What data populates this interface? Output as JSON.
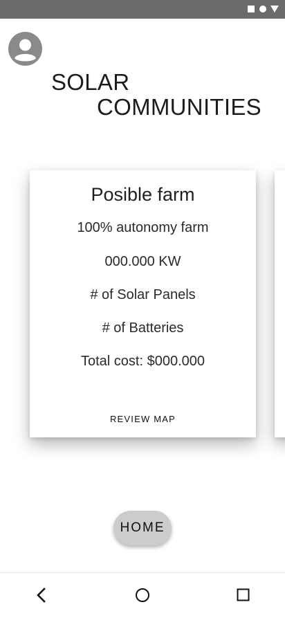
{
  "status_bar": {
    "icons": [
      "square-icon",
      "circle-icon",
      "triangle-icon"
    ]
  },
  "header": {
    "avatar_icon": "account-circle-icon",
    "title_line1": "SOLAR",
    "title_line2": "COMMUNITIES"
  },
  "card": {
    "title": "Posible farm",
    "autonomy": "100% autonomy farm",
    "power": "000.000 KW",
    "panels": "# of Solar Panels",
    "batteries": "# of Batteries",
    "total_cost": "Total cost: $000.000",
    "action_label": "REVIEW MAP"
  },
  "home_button": {
    "label": "HOME"
  },
  "nav_bar": {
    "icons": [
      "back-icon",
      "home-circle-icon",
      "recents-icon"
    ]
  },
  "colors": {
    "status_bar": "#6b6b6b",
    "button_bg": "#cccccc",
    "avatar": "#8a8a8a"
  }
}
